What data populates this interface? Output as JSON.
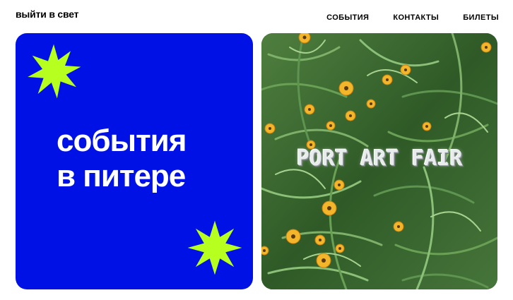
{
  "header": {
    "brand": "выйти в свет",
    "nav": [
      {
        "label": "СОБЫТИЯ"
      },
      {
        "label": "КОНТАКТЫ"
      },
      {
        "label": "БИЛЕТЫ"
      }
    ]
  },
  "hero": {
    "title_line1": "события",
    "title_line2": "в питере",
    "accent_color": "#b6ff1f",
    "background_color": "#0011e6"
  },
  "promo": {
    "title": "PORT ART FAIR",
    "image": "grass-with-yellow-flowers"
  }
}
